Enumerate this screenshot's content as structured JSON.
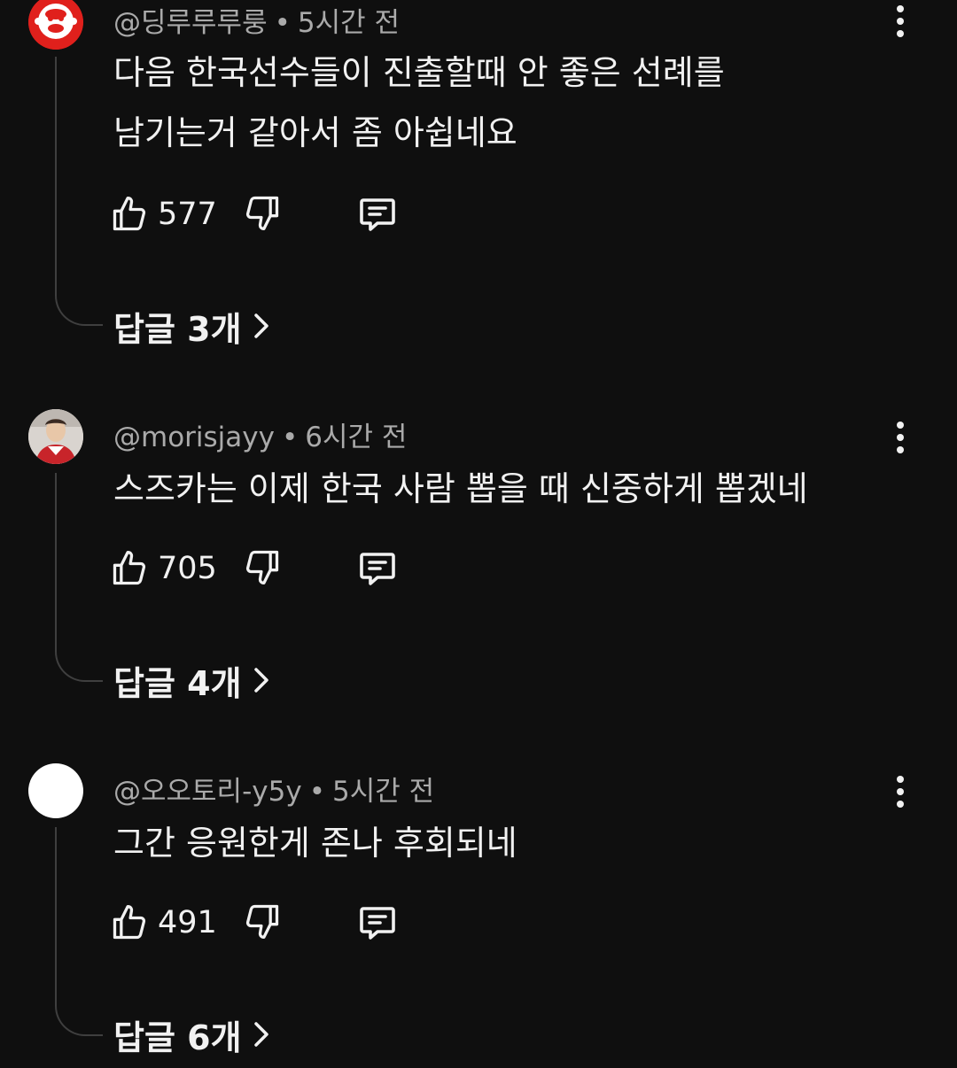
{
  "comments": [
    {
      "handle": "@딩루루루룽",
      "time": "5시간 전",
      "text_lines": [
        "다음 한국선수들이 진출할때 안 좋은 선례를",
        "남기는거 같아서 좀 아쉽네요"
      ],
      "likes": "577",
      "replies_label": "답글 3개",
      "avatar": "red-monkey-avatar"
    },
    {
      "handle": "@morisjayy",
      "time": "6시간 전",
      "text_lines": [
        "스즈카는 이제 한국 사람 뽑을 때 신중하게 뽑겠네"
      ],
      "likes": "705",
      "replies_label": "답글 4개",
      "avatar": "photo-avatar"
    },
    {
      "handle": "@오오토리-y5y",
      "time": "5시간 전",
      "text_lines": [
        "그간 응원한게 존나 후회되네"
      ],
      "likes": "491",
      "replies_label": "답글 6개",
      "avatar": "white-avatar"
    }
  ],
  "separator": "•",
  "icons": {
    "like": "thumbs-up-icon",
    "dislike": "thumbs-down-icon",
    "reply": "comment-icon",
    "more": "more-vert-icon",
    "chevron": "chevron-right-icon"
  },
  "colors": {
    "background": "#0f0f0f",
    "text": "#f1f1f1",
    "meta": "#aaaaaa",
    "thread_line": "#3f3f3f",
    "avatar_red": "#e0201c"
  }
}
